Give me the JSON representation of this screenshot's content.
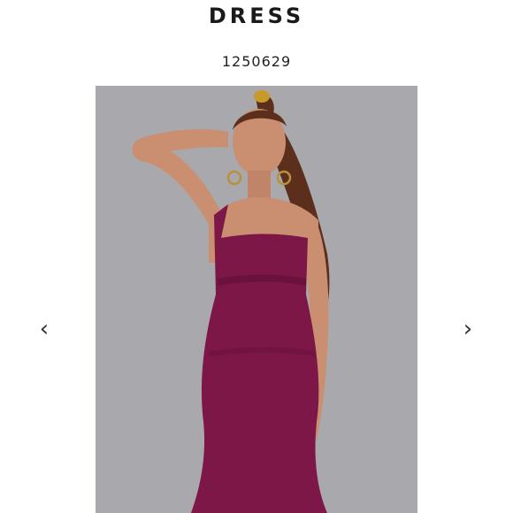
{
  "product": {
    "title": "DRESS",
    "sku": "1250629"
  },
  "gallery": {
    "prev_label": "‹",
    "next_label": "›",
    "image_icon": "product-photo-model-in-purple-dress"
  },
  "colors": {
    "photo_background": "#a9a8ad",
    "dress": "#7d1748",
    "skin": "#c98f70",
    "hair": "#5b2f1c",
    "text": "#1a1a1a"
  }
}
